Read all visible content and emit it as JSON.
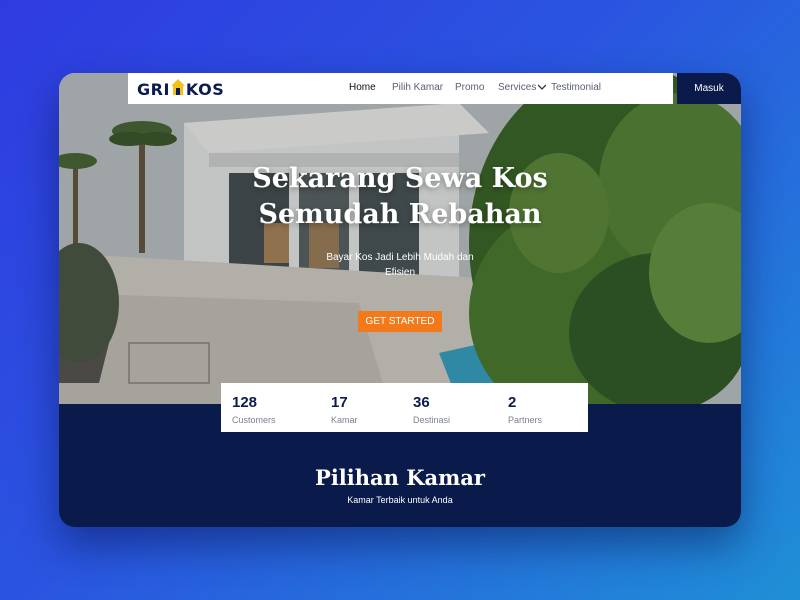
{
  "brand": {
    "logo_left": "GRI",
    "logo_right": "KOS",
    "logo_icon": "house-icon"
  },
  "nav": {
    "items": [
      {
        "label": "Home",
        "active": true
      },
      {
        "label": "Pilih Kamar",
        "active": false
      },
      {
        "label": "Promo",
        "active": false
      },
      {
        "label": "Services",
        "active": false,
        "has_dropdown": true
      },
      {
        "label": "Testimonial",
        "active": false
      }
    ],
    "login_label": "Masuk"
  },
  "hero": {
    "headline_line1": "Sekarang Sewa Kos",
    "headline_line2": "Semudah Rebahan",
    "subtitle": "Bayar Kos Jadi Lebih Mudah dan Efisien",
    "cta_label": "GET STARTED"
  },
  "stats": [
    {
      "value": "128",
      "label": "Customers"
    },
    {
      "value": "17",
      "label": "Kamar"
    },
    {
      "value": "36",
      "label": "Destinasi"
    },
    {
      "value": "2",
      "label": "Partners"
    }
  ],
  "section": {
    "title": "Pilihan Kamar",
    "subtitle": "Kamar Terbaik untuk Anda"
  },
  "colors": {
    "navy": "#0a1a4a",
    "accent": "#f27a1a",
    "background": "#2a55e0"
  }
}
